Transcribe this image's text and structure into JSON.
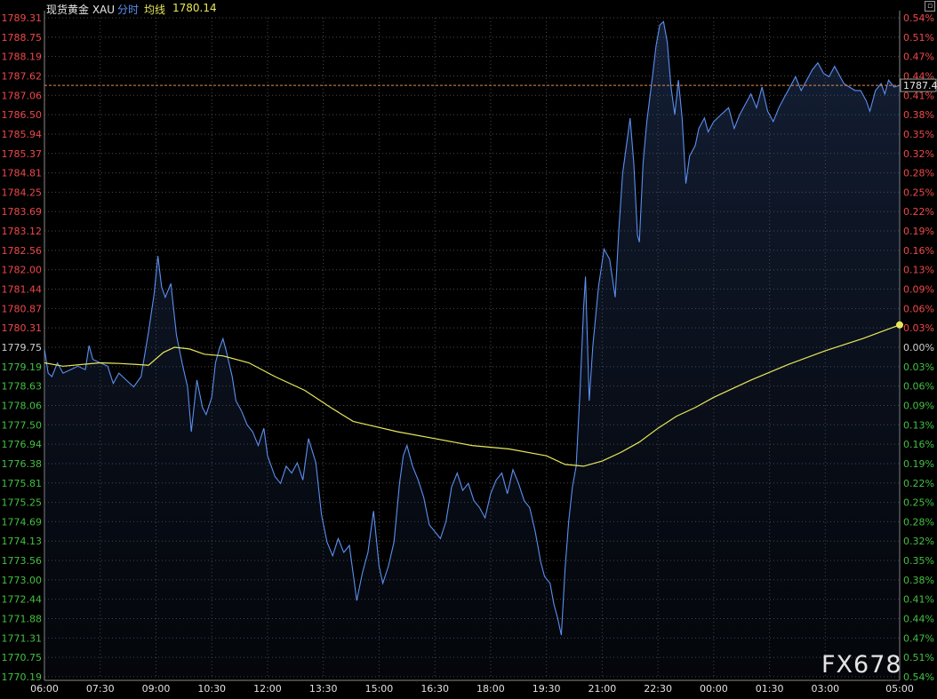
{
  "header": {
    "instrument": "现货黄金 XAU",
    "mode": "分时",
    "avg_label": "均线",
    "avg_value": "1780.14"
  },
  "corner_icon": "restore-window-icon",
  "watermark": "FX678",
  "colors": {
    "background": "#000000",
    "price_line": "#5b8ff0",
    "avg_line": "#e8e85a",
    "up": "#f04848",
    "down": "#43c043",
    "neutral": "#cfcfcf",
    "grid": "#4a4a4a",
    "reference": "#e08a4a"
  },
  "chart_data": {
    "type": "line",
    "title": "",
    "xlabel": "",
    "ylabel": "",
    "x_ticks": [
      "06:00",
      "07:30",
      "09:00",
      "10:30",
      "12:00",
      "13:30",
      "15:00",
      "16:30",
      "18:00",
      "19:30",
      "21:00",
      "22:30",
      "00:00",
      "01:30",
      "03:00",
      "05:00"
    ],
    "x_tick_hours": [
      0,
      1.5,
      3,
      4.5,
      6,
      7.5,
      9,
      10.5,
      12,
      13.5,
      15,
      16.5,
      18,
      19.5,
      21,
      23
    ],
    "x_range_hours": [
      0,
      23
    ],
    "y_left_ticks": [
      "1789.31",
      "1788.75",
      "1788.19",
      "1787.62",
      "1787.06",
      "1786.50",
      "1785.94",
      "1785.37",
      "1784.81",
      "1784.25",
      "1783.69",
      "1783.12",
      "1782.56",
      "1782.00",
      "1781.44",
      "1780.87",
      "1780.31",
      "1779.75",
      "1779.19",
      "1778.63",
      "1778.06",
      "1777.50",
      "1776.94",
      "1776.38",
      "1775.81",
      "1775.25",
      "1774.69",
      "1774.13",
      "1773.56",
      "1773.00",
      "1772.44",
      "1771.88",
      "1771.31",
      "1770.75",
      "1770.19"
    ],
    "y_right_ticks": [
      "0.54%",
      "0.51%",
      "0.47%",
      "0.44%",
      "0.41%",
      "0.38%",
      "0.35%",
      "0.32%",
      "0.28%",
      "0.25%",
      "0.22%",
      "0.19%",
      "0.16%",
      "0.13%",
      "0.09%",
      "0.06%",
      "0.03%",
      "0.00%",
      "0.03%",
      "0.06%",
      "0.09%",
      "0.13%",
      "0.16%",
      "0.19%",
      "0.22%",
      "0.25%",
      "0.28%",
      "0.32%",
      "0.35%",
      "0.38%",
      "0.41%",
      "0.44%",
      "0.47%",
      "0.51%",
      "0.54%"
    ],
    "ylim": [
      1770.19,
      1789.31
    ],
    "prev_close": 1779.75,
    "current_price_label": "1787.4",
    "current_price": 1787.35,
    "series": [
      {
        "name": "分时",
        "points": [
          [
            0,
            1779.7
          ],
          [
            0.1,
            1779.0
          ],
          [
            0.2,
            1778.9
          ],
          [
            0.35,
            1779.3
          ],
          [
            0.5,
            1779.0
          ],
          [
            0.7,
            1779.1
          ],
          [
            0.9,
            1779.2
          ],
          [
            1.1,
            1779.1
          ],
          [
            1.2,
            1779.8
          ],
          [
            1.3,
            1779.4
          ],
          [
            1.5,
            1779.3
          ],
          [
            1.7,
            1779.2
          ],
          [
            1.85,
            1778.7
          ],
          [
            2.0,
            1779.0
          ],
          [
            2.2,
            1778.8
          ],
          [
            2.4,
            1778.6
          ],
          [
            2.6,
            1778.9
          ],
          [
            2.8,
            1780.2
          ],
          [
            2.95,
            1781.3
          ],
          [
            3.05,
            1782.4
          ],
          [
            3.15,
            1781.5
          ],
          [
            3.25,
            1781.2
          ],
          [
            3.4,
            1781.6
          ],
          [
            3.55,
            1780.1
          ],
          [
            3.7,
            1779.3
          ],
          [
            3.85,
            1778.6
          ],
          [
            3.95,
            1777.3
          ],
          [
            4.1,
            1778.8
          ],
          [
            4.25,
            1778.0
          ],
          [
            4.35,
            1777.8
          ],
          [
            4.5,
            1778.3
          ],
          [
            4.6,
            1779.3
          ],
          [
            4.7,
            1779.7
          ],
          [
            4.8,
            1780.0
          ],
          [
            4.9,
            1779.6
          ],
          [
            5.05,
            1778.9
          ],
          [
            5.15,
            1778.2
          ],
          [
            5.3,
            1777.9
          ],
          [
            5.45,
            1777.5
          ],
          [
            5.6,
            1777.3
          ],
          [
            5.75,
            1776.9
          ],
          [
            5.9,
            1777.4
          ],
          [
            6.0,
            1776.6
          ],
          [
            6.2,
            1776.0
          ],
          [
            6.35,
            1775.8
          ],
          [
            6.5,
            1776.3
          ],
          [
            6.65,
            1776.1
          ],
          [
            6.8,
            1776.4
          ],
          [
            6.95,
            1775.9
          ],
          [
            7.1,
            1777.1
          ],
          [
            7.3,
            1776.4
          ],
          [
            7.45,
            1774.9
          ],
          [
            7.6,
            1774.1
          ],
          [
            7.75,
            1773.7
          ],
          [
            7.9,
            1774.2
          ],
          [
            8.05,
            1773.8
          ],
          [
            8.2,
            1774.0
          ],
          [
            8.4,
            1772.4
          ],
          [
            8.55,
            1773.2
          ],
          [
            8.7,
            1773.8
          ],
          [
            8.85,
            1775.0
          ],
          [
            9.0,
            1773.4
          ],
          [
            9.1,
            1772.9
          ],
          [
            9.25,
            1773.4
          ],
          [
            9.4,
            1774.1
          ],
          [
            9.55,
            1775.8
          ],
          [
            9.65,
            1776.6
          ],
          [
            9.75,
            1776.9
          ],
          [
            9.9,
            1776.3
          ],
          [
            10.05,
            1775.9
          ],
          [
            10.2,
            1775.4
          ],
          [
            10.35,
            1774.6
          ],
          [
            10.5,
            1774.4
          ],
          [
            10.65,
            1774.2
          ],
          [
            10.8,
            1774.7
          ],
          [
            10.95,
            1775.7
          ],
          [
            11.1,
            1776.1
          ],
          [
            11.25,
            1775.6
          ],
          [
            11.4,
            1775.8
          ],
          [
            11.55,
            1775.3
          ],
          [
            11.7,
            1775.1
          ],
          [
            11.85,
            1774.8
          ],
          [
            12.0,
            1775.5
          ],
          [
            12.15,
            1775.9
          ],
          [
            12.3,
            1776.1
          ],
          [
            12.45,
            1775.5
          ],
          [
            12.6,
            1776.2
          ],
          [
            12.75,
            1775.8
          ],
          [
            12.9,
            1775.3
          ],
          [
            13.05,
            1775.1
          ],
          [
            13.2,
            1774.4
          ],
          [
            13.35,
            1773.5
          ],
          [
            13.45,
            1773.1
          ],
          [
            13.6,
            1772.9
          ],
          [
            13.7,
            1772.3
          ],
          [
            13.8,
            1771.9
          ],
          [
            13.9,
            1771.4
          ],
          [
            14.0,
            1773.3
          ],
          [
            14.1,
            1774.7
          ],
          [
            14.2,
            1775.7
          ],
          [
            14.3,
            1776.3
          ],
          [
            14.4,
            1778.4
          ],
          [
            14.5,
            1780.9
          ],
          [
            14.55,
            1781.8
          ],
          [
            14.65,
            1778.2
          ],
          [
            14.75,
            1779.8
          ],
          [
            14.9,
            1781.5
          ],
          [
            15.05,
            1782.6
          ],
          [
            15.2,
            1782.3
          ],
          [
            15.35,
            1781.2
          ],
          [
            15.45,
            1783.2
          ],
          [
            15.55,
            1784.8
          ],
          [
            15.65,
            1785.6
          ],
          [
            15.75,
            1786.4
          ],
          [
            15.85,
            1785.1
          ],
          [
            15.95,
            1783.0
          ],
          [
            16.0,
            1782.8
          ],
          [
            16.1,
            1785.1
          ],
          [
            16.2,
            1786.3
          ],
          [
            16.35,
            1787.6
          ],
          [
            16.45,
            1788.5
          ],
          [
            16.55,
            1789.1
          ],
          [
            16.65,
            1789.2
          ],
          [
            16.75,
            1788.6
          ],
          [
            16.85,
            1787.3
          ],
          [
            16.95,
            1786.5
          ],
          [
            17.05,
            1787.5
          ],
          [
            17.15,
            1786.4
          ],
          [
            17.25,
            1784.5
          ],
          [
            17.35,
            1785.3
          ],
          [
            17.5,
            1785.6
          ],
          [
            17.6,
            1786.1
          ],
          [
            17.75,
            1786.4
          ],
          [
            17.85,
            1786.0
          ],
          [
            18.0,
            1786.3
          ],
          [
            18.2,
            1786.5
          ],
          [
            18.4,
            1786.7
          ],
          [
            18.55,
            1786.1
          ],
          [
            18.7,
            1786.5
          ],
          [
            18.85,
            1786.8
          ],
          [
            19.0,
            1787.1
          ],
          [
            19.15,
            1786.7
          ],
          [
            19.3,
            1787.3
          ],
          [
            19.45,
            1786.6
          ],
          [
            19.6,
            1786.3
          ],
          [
            19.75,
            1786.7
          ],
          [
            19.9,
            1787.0
          ],
          [
            20.05,
            1787.3
          ],
          [
            20.2,
            1787.6
          ],
          [
            20.35,
            1787.2
          ],
          [
            20.5,
            1787.5
          ],
          [
            20.65,
            1787.8
          ],
          [
            20.8,
            1788.0
          ],
          [
            20.95,
            1787.7
          ],
          [
            21.1,
            1787.6
          ],
          [
            21.25,
            1787.9
          ],
          [
            21.35,
            1787.7
          ],
          [
            21.5,
            1787.4
          ],
          [
            21.65,
            1787.3
          ],
          [
            21.8,
            1787.2
          ],
          [
            21.95,
            1787.2
          ],
          [
            22.1,
            1786.9
          ],
          [
            22.2,
            1786.6
          ],
          [
            22.35,
            1787.2
          ],
          [
            22.5,
            1787.4
          ],
          [
            22.6,
            1787.1
          ],
          [
            22.7,
            1787.5
          ],
          [
            22.85,
            1787.3
          ],
          [
            23.0,
            1787.35
          ]
        ]
      },
      {
        "name": "均线",
        "points": [
          [
            0,
            1779.3
          ],
          [
            0.5,
            1779.2
          ],
          [
            1.0,
            1779.25
          ],
          [
            1.5,
            1779.3
          ],
          [
            2.0,
            1779.28
          ],
          [
            2.5,
            1779.25
          ],
          [
            2.8,
            1779.23
          ],
          [
            3.2,
            1779.6
          ],
          [
            3.5,
            1779.75
          ],
          [
            3.9,
            1779.7
          ],
          [
            4.3,
            1779.55
          ],
          [
            4.8,
            1779.5
          ],
          [
            5.5,
            1779.3
          ],
          [
            6.2,
            1778.9
          ],
          [
            7.0,
            1778.5
          ],
          [
            7.7,
            1778.0
          ],
          [
            8.3,
            1777.6
          ],
          [
            8.9,
            1777.45
          ],
          [
            9.5,
            1777.3
          ],
          [
            10.5,
            1777.1
          ],
          [
            11.5,
            1776.9
          ],
          [
            12.5,
            1776.8
          ],
          [
            13.5,
            1776.6
          ],
          [
            14.0,
            1776.35
          ],
          [
            14.5,
            1776.3
          ],
          [
            15.0,
            1776.45
          ],
          [
            15.5,
            1776.7
          ],
          [
            16.0,
            1777.0
          ],
          [
            16.5,
            1777.4
          ],
          [
            17.0,
            1777.75
          ],
          [
            17.5,
            1778.0
          ],
          [
            18.0,
            1778.3
          ],
          [
            19.0,
            1778.8
          ],
          [
            20.0,
            1779.25
          ],
          [
            21.0,
            1779.65
          ],
          [
            22.0,
            1780.0
          ],
          [
            23.0,
            1780.4
          ]
        ]
      }
    ],
    "grid": true,
    "legend": "none"
  }
}
